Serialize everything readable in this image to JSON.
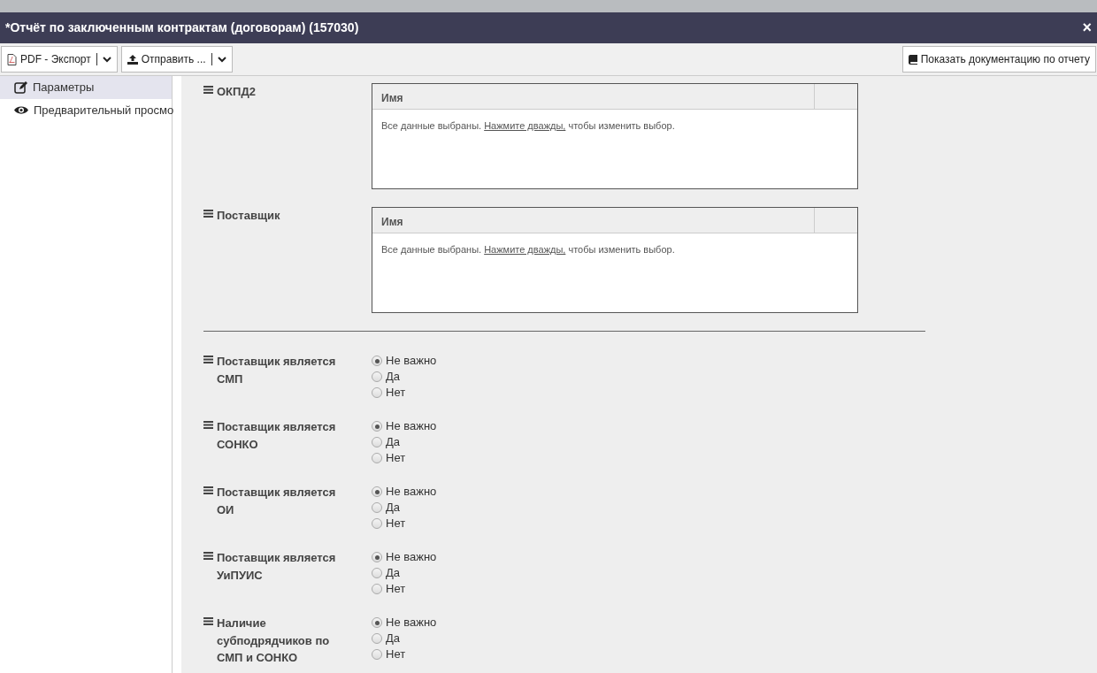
{
  "window": {
    "title": "*Отчёт по заключенным контрактам (договорам) (157030)",
    "close": "×"
  },
  "toolbar": {
    "buttons": [
      {
        "kind": "pdf",
        "label": "PDF - Экспорт"
      },
      {
        "kind": "upload",
        "label": "Отправить ..."
      }
    ],
    "doc_button": "Показать документацию по отчету"
  },
  "sidebar": {
    "items": [
      {
        "kind": "edit",
        "label": "Параметры",
        "selected": true
      },
      {
        "kind": "eye",
        "label": "Предварительный просмо",
        "selected": false
      }
    ]
  },
  "grids": [
    {
      "label": "ОКПД2",
      "column_1": "Имя",
      "message_before": "Все данные выбраны. ",
      "link": "Нажмите дважды,",
      "message_after": " чтобы изменить выбор."
    },
    {
      "label": "Поставщик",
      "column_1": "Имя",
      "message_before": "Все данные выбраны. ",
      "link": "Нажмите дважды,",
      "message_after": " чтобы изменить выбор."
    }
  ],
  "radio_groups": [
    {
      "label": "Поставщик является СМП",
      "options": [
        {
          "label": "Не важно",
          "selected": true
        },
        {
          "label": "Да",
          "selected": false
        },
        {
          "label": "Нет",
          "selected": false
        }
      ]
    },
    {
      "label": "Поставщик является СОНКО",
      "options": [
        {
          "label": "Не важно",
          "selected": true
        },
        {
          "label": "Да",
          "selected": false
        },
        {
          "label": "Нет",
          "selected": false
        }
      ]
    },
    {
      "label": "Поставщик является ОИ",
      "options": [
        {
          "label": "Не важно",
          "selected": true
        },
        {
          "label": "Да",
          "selected": false
        },
        {
          "label": "Нет",
          "selected": false
        }
      ]
    },
    {
      "label": "Поставщик является УиПУИС",
      "options": [
        {
          "label": "Не важно",
          "selected": true
        },
        {
          "label": "Да",
          "selected": false
        },
        {
          "label": "Нет",
          "selected": false
        }
      ]
    },
    {
      "label": "Наличие субподрядчиков по СМП и СОНКО",
      "options": [
        {
          "label": "Не важно",
          "selected": true
        },
        {
          "label": "Да",
          "selected": false
        },
        {
          "label": "Нет",
          "selected": false
        }
      ]
    }
  ]
}
